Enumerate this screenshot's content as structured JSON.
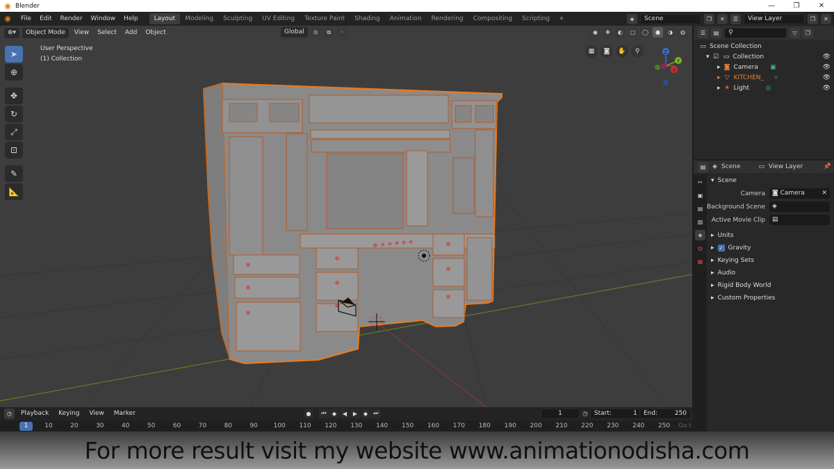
{
  "window": {
    "title": "Blender",
    "controls": [
      "—",
      "❐",
      "✕"
    ]
  },
  "menubar": {
    "menus": [
      "File",
      "Edit",
      "Render",
      "Window",
      "Help"
    ],
    "workspaces": [
      "Layout",
      "Modeling",
      "Sculpting",
      "UV Editing",
      "Texture Paint",
      "Shading",
      "Animation",
      "Rendering",
      "Compositing",
      "Scripting"
    ],
    "active_workspace": "Layout",
    "add_workspace": "+",
    "scene_name": "Scene",
    "view_layer": "View Layer"
  },
  "viewport": {
    "mode": "Object Mode",
    "menus": [
      "View",
      "Select",
      "Add",
      "Object"
    ],
    "transform_orientation": "Global",
    "perspective_label": "User Perspective",
    "collection_label": "(1) Collection",
    "gizmo_axes": {
      "x": "X",
      "y": "Y",
      "z": "Z"
    }
  },
  "timeline": {
    "menus": [
      "Playback",
      "Keying",
      "View",
      "Marker"
    ],
    "current_frame": "1",
    "start_label": "Start:",
    "start": "1",
    "end_label": "End:",
    "end": "250",
    "ticks": [
      "1",
      "10",
      "20",
      "30",
      "40",
      "50",
      "60",
      "70",
      "80",
      "90",
      "100",
      "110",
      "120",
      "130",
      "140",
      "150",
      "160",
      "170",
      "180",
      "190",
      "200",
      "210",
      "220",
      "230",
      "240",
      "250"
    ],
    "go_label": "Go t"
  },
  "outliner": {
    "rows": [
      {
        "label": "Scene Collection",
        "color": "#dddddd"
      },
      {
        "label": "Collection",
        "color": "#dddddd"
      },
      {
        "label": "Camera",
        "color": "#dddddd"
      },
      {
        "label": "KITCHEN_",
        "color": "#e8833a"
      },
      {
        "label": "Light",
        "color": "#dddddd"
      }
    ]
  },
  "properties": {
    "header_scene": "Scene",
    "header_view_layer": "View Layer",
    "panel_title": "Scene",
    "camera_label": "Camera",
    "camera_value": "Camera",
    "background_scene_label": "Background Scene",
    "active_movie_clip_label": "Active Movie Clip",
    "subpanels": [
      "Units",
      "Gravity",
      "Keying Sets",
      "Audio",
      "Rigid Body World",
      "Custom Properties"
    ]
  },
  "caption": "For more result visit my website www.animationodisha.com",
  "colors": {
    "accent": "#4772b3",
    "selection": "#e8833a",
    "viewport_bg": "#3d3d3d"
  }
}
